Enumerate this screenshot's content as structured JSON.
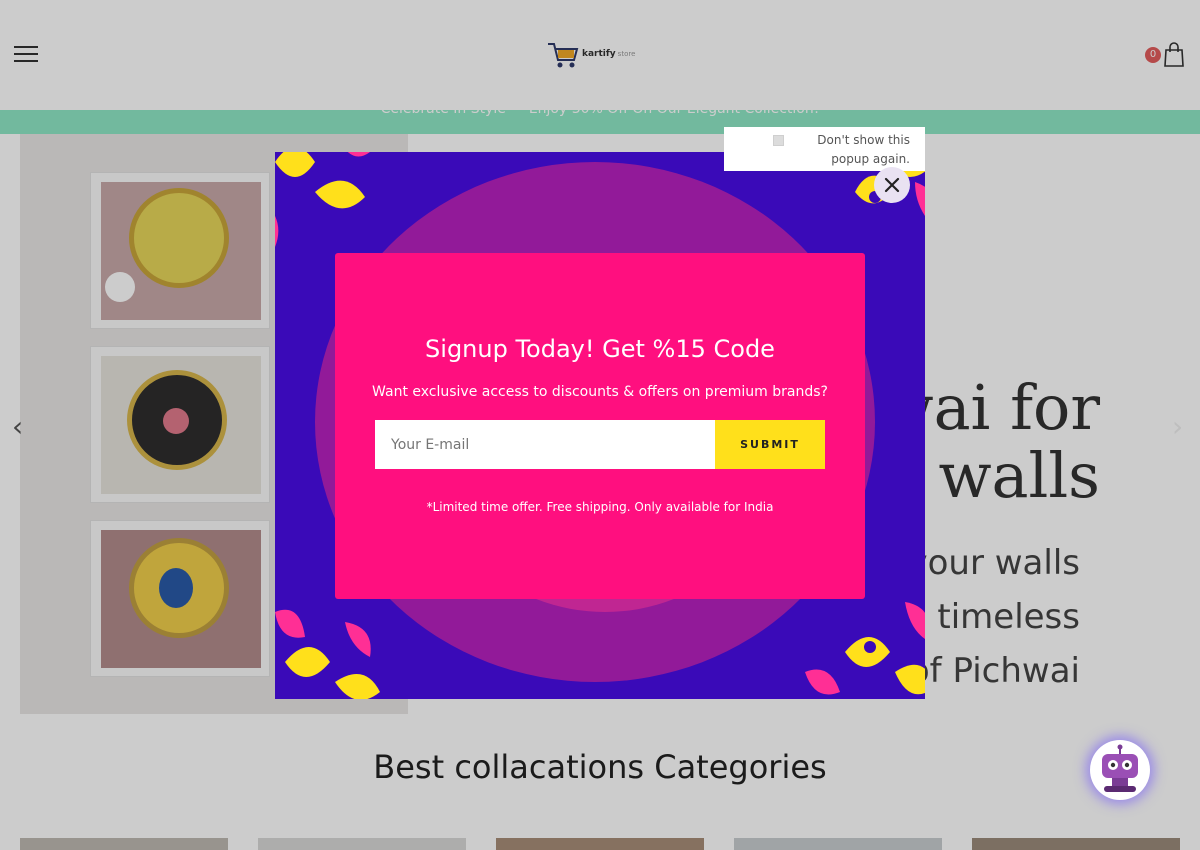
{
  "header": {
    "logo_text": "kartify",
    "logo_subtext": "store",
    "cart_count": "0"
  },
  "announcement": "Celebrate In Style — Enjoy 30% Off On Our Elegant Collection!",
  "hero": {
    "title_lines": [
      "Pichwai for",
      "walls"
    ],
    "subtitle_lines": [
      "Adorn your walls",
      "with timeless",
      "art of Pichwai"
    ]
  },
  "section": {
    "title": "Best collacations Categories"
  },
  "popup": {
    "title": "Signup Today! Get %15 Code",
    "description": "Want exclusive access to discounts & offers on premium brands?",
    "email_placeholder": "Your E-mail",
    "submit_label": "SUBMIT",
    "note": "*Limited time offer. Free shipping. Only available for India",
    "dont_show_label": "Don't show this popup again."
  },
  "colors": {
    "popup_bg": "#3a0ab8",
    "popup_card": "#ff0f7f",
    "submit": "#ffe01b",
    "announce": "#8fe8c6",
    "cart_badge": "#e35d5d"
  },
  "icons": {
    "menu": "hamburger-icon",
    "cart": "shopping-bag-icon",
    "close": "close-icon",
    "chatbot": "robot-icon",
    "hero_prev": "chevron-left-icon",
    "hero_next": "chevron-right-icon"
  }
}
